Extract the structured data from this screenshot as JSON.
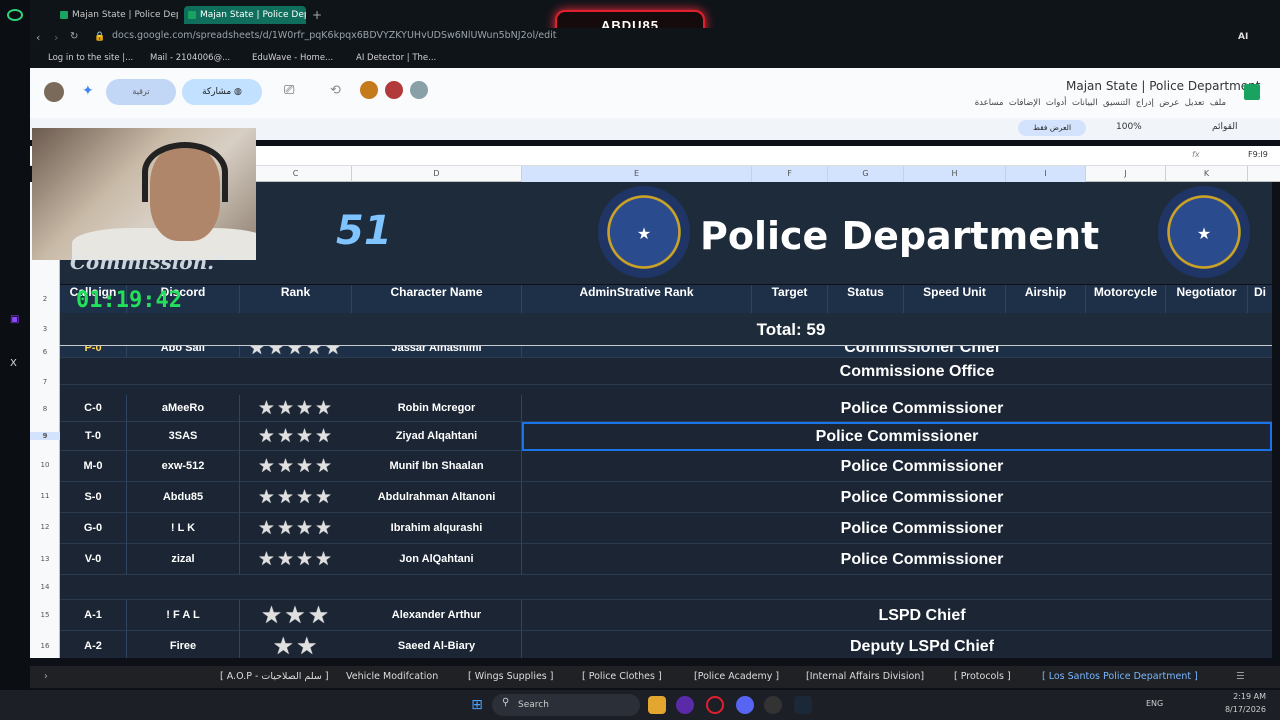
{
  "browser": {
    "tabs": [
      {
        "label": "Majan State | Police Depart"
      },
      {
        "label": "Majan State | Police Depart"
      }
    ],
    "url": "docs.google.com/spreadsheets/d/1W0rfr_pqK6kpqx6BDVYZKYUHvUDSw6NlUWun5bNJ2ol/edit",
    "bookmarks": [
      "Log in to the site |...",
      "Mail - 2104006@...",
      "EduWave - Home...",
      "AI Detector | The..."
    ],
    "streamer_name": "ABDU85",
    "ai_label": "AI"
  },
  "sheets": {
    "doc_title": "Majan State | Police Department",
    "menu": [
      "ملف",
      "تعديل",
      "عرض",
      "إدراج",
      "التنسيق",
      "البيانات",
      "أدوات",
      "الإضافات",
      "مساعدة"
    ],
    "share_label": "مشاركة",
    "present_label": "ترقية",
    "view_only": "العرض فقط",
    "zoom": "100%",
    "menus_search": "القوائم",
    "cell_ref": "F9:I9",
    "fx": "fx",
    "columns": [
      "C",
      "D",
      "E",
      "F",
      "G",
      "H",
      "I",
      "J",
      "K"
    ],
    "row_numbers": [
      "2",
      "3",
      "6",
      "7",
      "8",
      "9",
      "10",
      "11",
      "12",
      "13",
      "14",
      "15",
      "16"
    ]
  },
  "banner": {
    "title": "Police Department",
    "logo_text": "51"
  },
  "table": {
    "headers": {
      "callsign": "Callsign",
      "discord": "Discord",
      "rank": "Rank",
      "character": "Character Name",
      "admin_rank": "AdminStrative Rank",
      "target": "Target",
      "status": "Status",
      "speed": "Speed Unit",
      "airship": "Airship",
      "motorcycle": "Motorcycle",
      "negotiator": "Negotiator",
      "extra": "Di"
    },
    "total": "Total: 59",
    "rows": [
      {
        "callsign": "P-0",
        "discord": "Abo Saif",
        "stars": "★★★★★",
        "name": "Jassar Alhashimi",
        "rank_title": "Commissioner Chief"
      },
      {
        "section": "Commissione Office"
      },
      {
        "callsign": "C-0",
        "discord": "aMeeRo",
        "stars": "★★★★",
        "name": "Robin Mcregor",
        "rank_title": "Police Commissioner"
      },
      {
        "callsign": "T-0",
        "discord": "3SAS",
        "stars": "★★★★",
        "name": "Ziyad Alqahtani",
        "rank_title": "Police Commissioner"
      },
      {
        "callsign": "M-0",
        "discord": "exw-512",
        "stars": "★★★★",
        "name": "Munif Ibn Shaalan",
        "rank_title": "Police Commissioner"
      },
      {
        "callsign": "S-0",
        "discord": "Abdu85",
        "stars": "★★★★",
        "name": "Abdulrahman Altanoni",
        "rank_title": "Police Commissioner"
      },
      {
        "callsign": "G-0",
        "discord": "! L K",
        "stars": "★★★★",
        "name": "Ibrahim alqurashi",
        "rank_title": "Police Commissioner"
      },
      {
        "callsign": "V-0",
        "discord": "zizal",
        "stars": "★★★★",
        "name": "Jon AlQahtani",
        "rank_title": "Police Commissioner"
      },
      {
        "empty": true
      },
      {
        "callsign": "A-1",
        "discord": "! F A L",
        "stars": "★★★",
        "name": "Alexander Arthur",
        "rank_title": "LSPD Chief"
      },
      {
        "callsign": "A-2",
        "discord": "Firee",
        "stars": "★★",
        "name": "Saeed Al-Biary",
        "rank_title": "Deputy LSPd Chief"
      }
    ]
  },
  "overlay": {
    "timer": "01:19:42",
    "commission_text": "Commission.\""
  },
  "sheet_tabs": [
    "[ A.O.P - سلم الصلاحيات ]",
    "Vehicle Modifcation",
    "[ Wings Supplies ]",
    "[ Police Clothes ]",
    "[Police Academy ]",
    "[Internal Affairs Division]",
    "[ Protocols ]",
    "[ Los Santos Police Department ]"
  ],
  "taskbar": {
    "search": "Search",
    "lang": "ENG",
    "time": "2:19 AM",
    "date": "8/17/2026"
  }
}
